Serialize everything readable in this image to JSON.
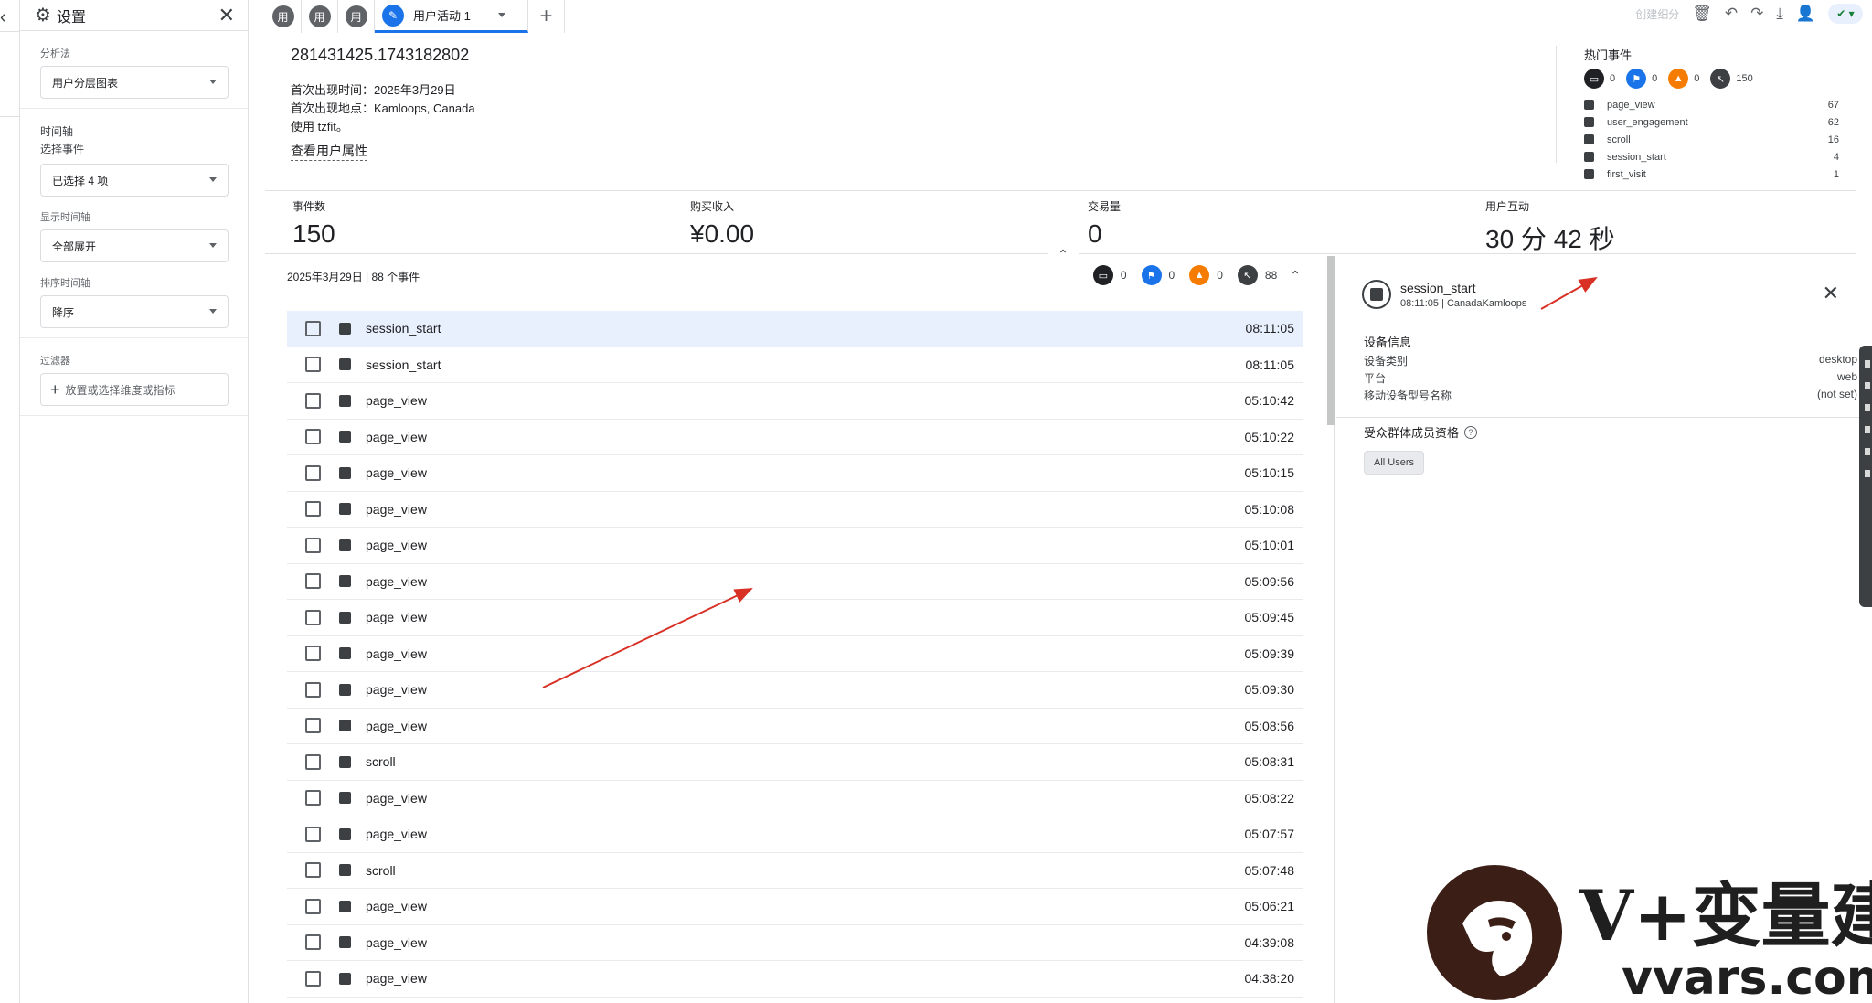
{
  "settings": {
    "title": "设置",
    "sections": {
      "technique_label": "分析法",
      "technique_value": "用户分层图表",
      "timeline_label": "时间轴",
      "select_events_label": "选择事件",
      "select_events_value": "已选择 4 项",
      "display_timeline_label": "显示时间轴",
      "display_timeline_value": "全部展开",
      "sort_timeline_label": "排序时间轴",
      "sort_timeline_value": "降序",
      "filters_label": "过滤器",
      "filters_placeholder": "放置或选择维度或指标"
    }
  },
  "tabs": {
    "icons": [
      "用",
      "用",
      "用"
    ],
    "active_label": "用户活动 1",
    "add": "+"
  },
  "toolbar": {
    "create_segment": "创建细分"
  },
  "profile": {
    "user_id": "281431425.1743182802",
    "first_seen": "首次出现时间：2025年3月29日",
    "first_location": "首次出现地点：Kamloops, Canada",
    "uses": "使用 tzfit。",
    "view_properties": "查看用户属性"
  },
  "top_events": {
    "title": "热门事件",
    "counts": [
      "0",
      "0",
      "0",
      "150"
    ],
    "items": [
      {
        "name": "page_view",
        "count": "67"
      },
      {
        "name": "user_engagement",
        "count": "62"
      },
      {
        "name": "scroll",
        "count": "16"
      },
      {
        "name": "session_start",
        "count": "4"
      },
      {
        "name": "first_visit",
        "count": "1"
      }
    ]
  },
  "metrics": [
    {
      "label": "事件数",
      "value": "150"
    },
    {
      "label": "购买收入",
      "value": "¥0.00"
    },
    {
      "label": "交易量",
      "value": "0"
    },
    {
      "label": "用户互动",
      "value": "30 分 42 秒"
    }
  ],
  "event_list": {
    "heading": "2025年3月29日 | 88 个事件",
    "counts": [
      "0",
      "0",
      "0",
      "88"
    ],
    "rows": [
      {
        "name": "session_start",
        "time": "08:11:05"
      },
      {
        "name": "session_start",
        "time": "08:11:05"
      },
      {
        "name": "page_view",
        "time": "05:10:42"
      },
      {
        "name": "page_view",
        "time": "05:10:22"
      },
      {
        "name": "page_view",
        "time": "05:10:15"
      },
      {
        "name": "page_view",
        "time": "05:10:08"
      },
      {
        "name": "page_view",
        "time": "05:10:01"
      },
      {
        "name": "page_view",
        "time": "05:09:56"
      },
      {
        "name": "page_view",
        "time": "05:09:45"
      },
      {
        "name": "page_view",
        "time": "05:09:39"
      },
      {
        "name": "page_view",
        "time": "05:09:30"
      },
      {
        "name": "page_view",
        "time": "05:08:56"
      },
      {
        "name": "scroll",
        "time": "05:08:31"
      },
      {
        "name": "page_view",
        "time": "05:08:22"
      },
      {
        "name": "page_view",
        "time": "05:07:57"
      },
      {
        "name": "scroll",
        "time": "05:07:48"
      },
      {
        "name": "page_view",
        "time": "05:06:21"
      },
      {
        "name": "page_view",
        "time": "04:39:08"
      },
      {
        "name": "page_view",
        "time": "04:38:20"
      }
    ]
  },
  "detail": {
    "event_name": "session_start",
    "event_sub": "08:11:05 | CanadaKamloops",
    "device_title": "设备信息",
    "device_rows": [
      {
        "label": "设备类别",
        "value": "desktop"
      },
      {
        "label": "平台",
        "value": "web"
      },
      {
        "label": "移动设备型号名称",
        "value": "(not set)"
      }
    ],
    "audience_title": "受众群体成员资格",
    "audience_chip": "All Users"
  },
  "watermark": {
    "brand": "V+变量建站",
    "url": "vvars.com"
  },
  "colors": {
    "accent": "#1a73e8",
    "selected_row": "#e8f0fe",
    "annotation_arrow": "#d93025",
    "orange_icon": "#f57c00"
  }
}
